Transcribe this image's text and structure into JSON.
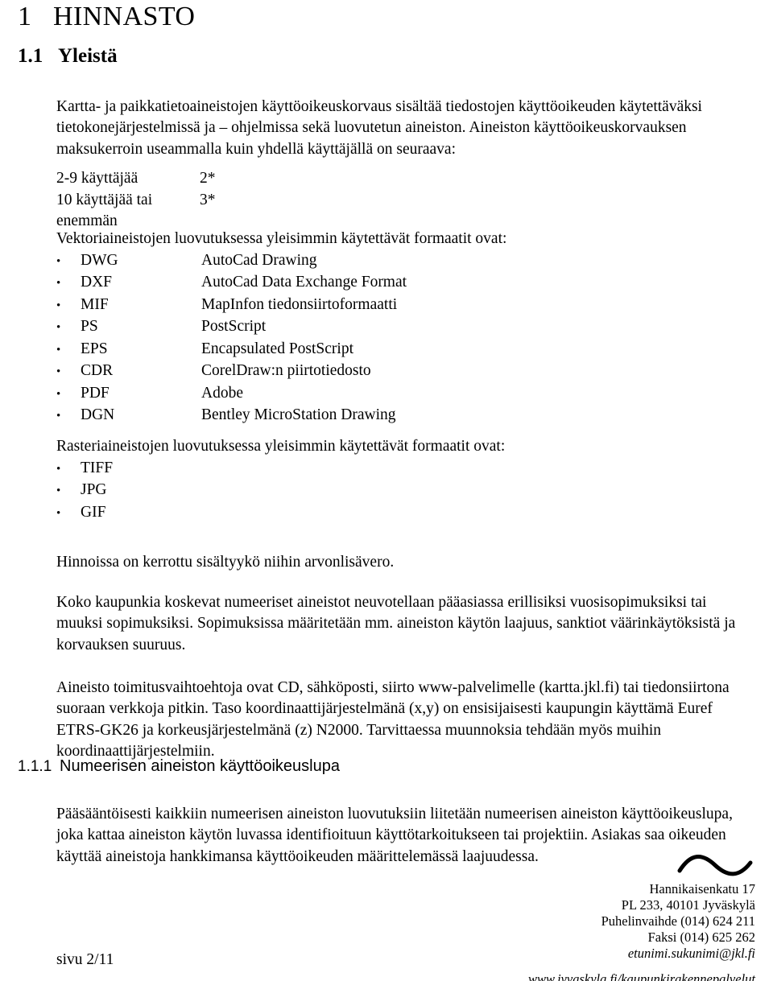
{
  "document": {
    "chapter": {
      "number": "1",
      "title": "HINNASTO"
    },
    "section": {
      "number": "1.1",
      "title": "Yleistä"
    },
    "subsection": {
      "number": "1.1.1",
      "title": "Numeerisen aineiston käyttöoikeuslupa"
    },
    "intro_paragraph": "Kartta- ja paikkatietoaineistojen käyttöoikeuskorvaus sisältää tiedostojen käyttöoikeuden käytettäväksi tietokonejärjestelmissä ja – ohjelmissa sekä luovutetun aineiston. Aineiston käyttöoikeuskorvauksen maksukerroin useammalla kuin yhdellä käyttäjällä on seuraava:",
    "rates": {
      "rows": [
        {
          "label": "2-9 käyttäjää",
          "value": "2*"
        },
        {
          "label": "10 käyttäjää tai enemmän",
          "value": "3*"
        }
      ]
    },
    "vector_formats": {
      "intro": "Vektoriaineistojen luovutuksessa yleisimmin käytettävät formaatit ovat:",
      "bullet": "•",
      "items": [
        {
          "code": "DWG",
          "desc": "AutoCad Drawing"
        },
        {
          "code": "DXF",
          "desc": "AutoCad Data Exchange Format"
        },
        {
          "code": "MIF",
          "desc": "MapInfon tiedonsiirtoformaatti"
        },
        {
          "code": "PS",
          "desc": "PostScript"
        },
        {
          "code": "EPS",
          "desc": "Encapsulated PostScript"
        },
        {
          "code": "CDR",
          "desc": "CorelDraw:n piirtotiedosto"
        },
        {
          "code": "PDF",
          "desc": "Adobe"
        },
        {
          "code": "DGN",
          "desc": "Bentley MicroStation Drawing"
        }
      ]
    },
    "raster_formats": {
      "intro": "Rasteriaineistojen luovutuksessa yleisimmin käytettävät formaatit ovat:",
      "bullet": "•",
      "items": [
        {
          "code": "TIFF",
          "desc": ""
        },
        {
          "code": "JPG",
          "desc": ""
        },
        {
          "code": "GIF",
          "desc": ""
        }
      ]
    },
    "vat_note": "Hinnoissa on kerrottu sisältyykö niihin arvonlisävero.",
    "contracts_paragraph": "Koko kaupunkia koskevat numeeriset aineistot neuvotellaan pääasiassa erillisiksi vuosisopimuksiksi tai muuksi sopimuksiksi. Sopimuksissa määritetään mm. aineiston käytön laajuus, sanktiot väärinkäytöksistä ja korvauksen suuruus.",
    "delivery_paragraph": "Aineisto toimitusvaihtoehtoja ovat CD, sähköposti, siirto www-palvelimelle (kartta.jkl.fi) tai tiedonsiirtona suoraan verkkoja pitkin. Taso koordinaattijärjestelmänä (x,y) on ensisijaisesti kaupungin käyttämä Euref ETRS-GK26 ja korkeusjärjestelmänä (z) N2000. Tarvittaessa muunnoksia tehdään myös muihin koordinaattijärjestelmiin.",
    "license_paragraph": "Pääsääntöisesti kaikkiin numeerisen aineiston luovutuksiin liitetään numeerisen aineiston käyttöoikeuslupa, joka kattaa aineiston käytön luvassa identifioituun käyttötarkoitukseen tai projektiin. Asiakas saa oikeuden käyttää aineistoja hankkimansa käyttöoikeuden määrittelemässä laajuudessa."
  },
  "footer": {
    "street": "Hannikaisenkatu 17",
    "postal": "PL 233, 40101 Jyväskylä",
    "phone": "Puhelinvaihde (014) 624 211",
    "fax": "Faksi (014) 625 262",
    "email": "etunimi.sukunimi@jkl.fi",
    "web": "www.jyvaskyla.fi/kaupunkirakennepalvelut",
    "page_number": "sivu 2/11"
  },
  "colors": {
    "text": "#000000",
    "background": "#ffffff"
  }
}
